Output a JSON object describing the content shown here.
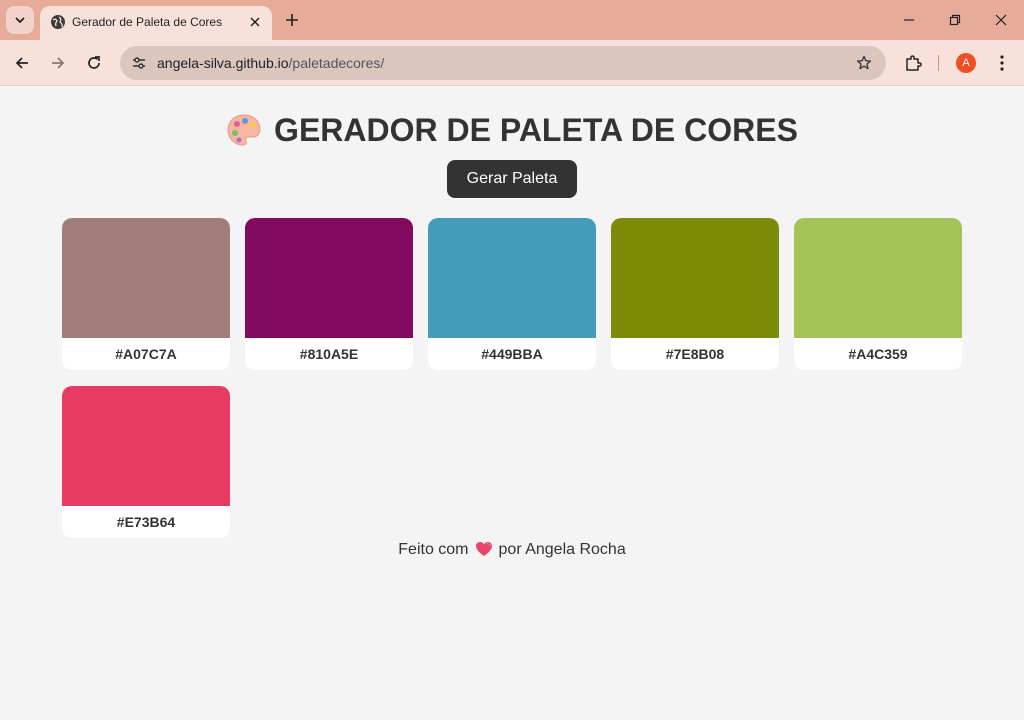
{
  "browser": {
    "tab_title": "Gerador de Paleta de Cores",
    "url_host": "angela-silva.github.io",
    "url_path": "/paletadecores/",
    "profile_initial": "A"
  },
  "page": {
    "title": "GERADOR DE PALETA DE CORES",
    "generate_button": "Gerar Paleta",
    "colors": [
      {
        "hex": "#A07C7A",
        "color": "#A07C7A"
      },
      {
        "hex": "#810A5E",
        "color": "#810A5E"
      },
      {
        "hex": "#449BBA",
        "color": "#449BBA"
      },
      {
        "hex": "#7E8B08",
        "color": "#7E8B08"
      },
      {
        "hex": "#A4C359",
        "color": "#A4C359"
      },
      {
        "hex": "#E73B64",
        "color": "#E73B64"
      }
    ],
    "footer_prefix": "Feito com",
    "footer_suffix": "por Angela Rocha"
  }
}
